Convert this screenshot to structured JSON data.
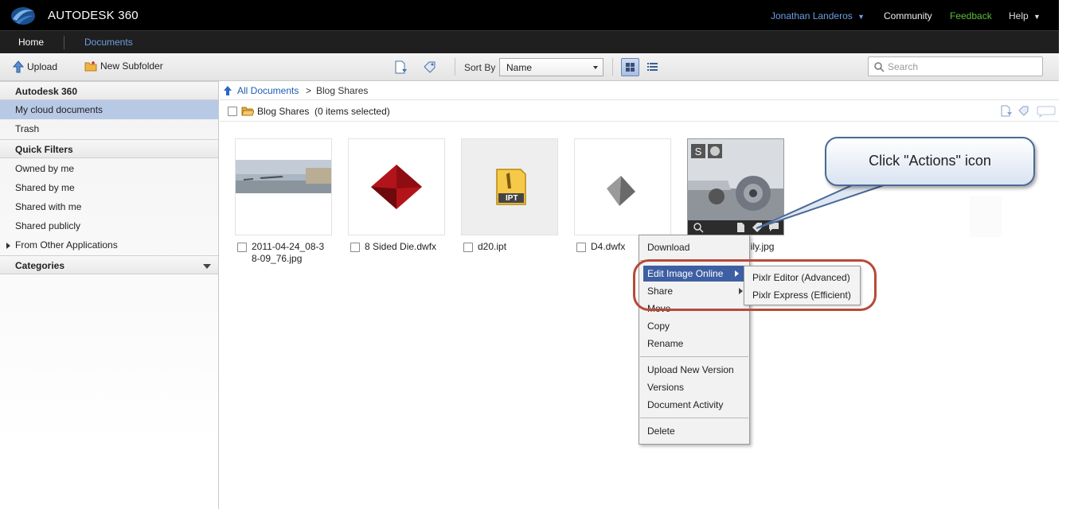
{
  "brand": {
    "name": "AUTODESK 360"
  },
  "topnav": {
    "user": "Jonathan Landeros",
    "community": "Community",
    "feedback": "Feedback",
    "help": "Help"
  },
  "nav": {
    "home": "Home",
    "documents": "Documents"
  },
  "toolbar": {
    "upload": "Upload",
    "new_subfolder": "New Subfolder",
    "sort_by": "Sort By",
    "sort_value": "Name",
    "search_placeholder": "Search"
  },
  "sidebar": {
    "autodesk360": "Autodesk 360",
    "my_cloud": "My cloud documents",
    "trash": "Trash",
    "quick_filters": "Quick Filters",
    "owned": "Owned by me",
    "shared_by": "Shared by me",
    "shared_with": "Shared with me",
    "shared_publicly": "Shared publicly",
    "other_apps": "From Other Applications",
    "categories": "Categories"
  },
  "breadcrumb": {
    "all_docs": "All Documents",
    "sep": ">",
    "current": "Blog Shares"
  },
  "folder": {
    "name": "Blog Shares",
    "selected": "(0 items selected)"
  },
  "files": [
    {
      "name_line1": "2011-04-24_08-3",
      "name_line2": "8-09_76.jpg"
    },
    {
      "name_line1": "8 Sided Die.dwfx"
    },
    {
      "name_line1": "d20.ipt",
      "badge": "IPT"
    },
    {
      "name_line1": "D4.dwfx"
    },
    {
      "name_line1": "Photo Family.jpg"
    }
  ],
  "callout": {
    "text": "Click \"Actions\" icon"
  },
  "context_menu": {
    "download": "Download",
    "edit_online": "Edit Image Online",
    "share": "Share",
    "move": "Move",
    "copy": "Copy",
    "rename": "Rename",
    "upload_version": "Upload New Version",
    "versions": "Versions",
    "activity": "Document Activity",
    "delete": "Delete"
  },
  "submenu": {
    "pixlr_editor": "Pixlr Editor (Advanced)",
    "pixlr_express": "Pixlr Express (Efficient)"
  },
  "colors": {
    "accent": "#3e5fa3",
    "link": "#1d5db3",
    "feedback": "#5bbf3a",
    "highlight_ring": "#b64a3a"
  }
}
